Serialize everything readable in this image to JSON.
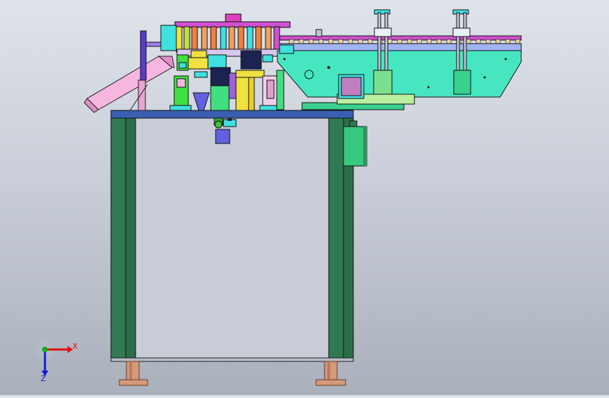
{
  "viewport": {
    "background_top": "#dfe3ea",
    "background_bottom": "#aab0bb"
  },
  "triad": {
    "x_label": "X",
    "z_label": "Z",
    "x_color": "#e01010",
    "y_color": "#10b010",
    "z_color": "#1020d0"
  },
  "palette": {
    "frame_green": "#2f7a52",
    "table_blue": "#3b5fb0",
    "conveyor_cyan": "#46e6c0",
    "rail_magenta": "#d050d0",
    "chute_pink": "#f6b6e0",
    "feet_copper": "#d49a7a",
    "block_navy": "#1b2350",
    "block_yellow": "#f0e040",
    "block_cyan": "#40e0e0",
    "panel_green": "#3ad090"
  }
}
